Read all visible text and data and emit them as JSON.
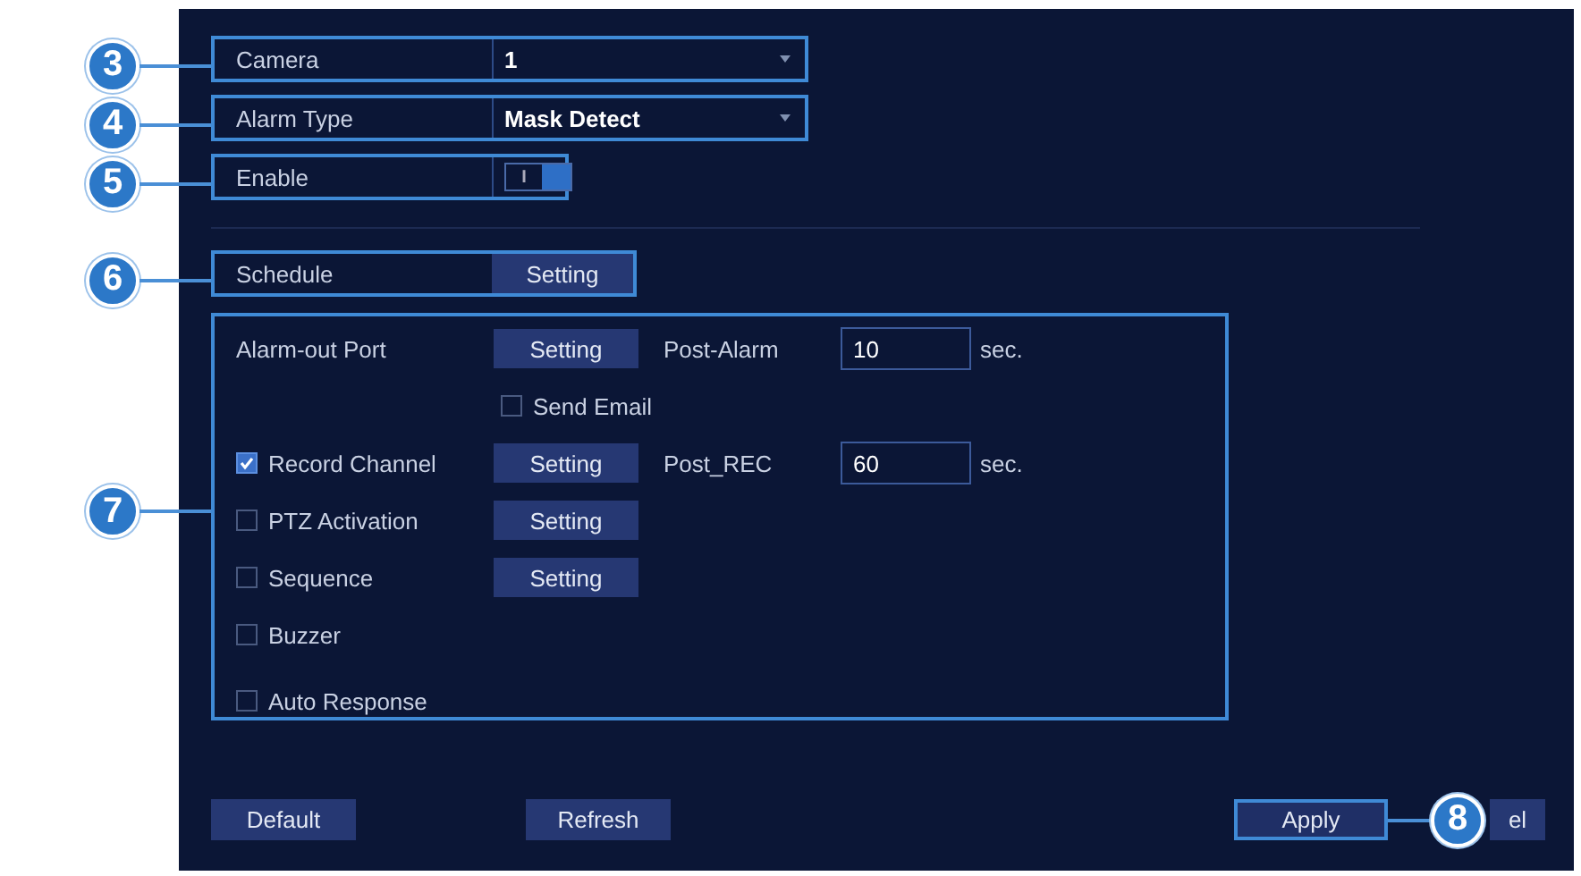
{
  "fields": [
    {
      "kind": "dropdown",
      "label": "Camera",
      "value": "1",
      "callout": "3"
    },
    {
      "kind": "dropdown",
      "label": "Alarm Type",
      "value": "Mask Detect",
      "callout": "4"
    },
    {
      "kind": "toggle",
      "label": "Enable",
      "on": true,
      "toggle_text": "I",
      "callout": "5"
    }
  ],
  "schedule": {
    "label": "Schedule",
    "button": "Setting",
    "callout": "6"
  },
  "actions": {
    "callout": "7",
    "rows": [
      {
        "kind": "plain",
        "label": "Alarm-out Port",
        "button": "Setting",
        "extra_label": "Post-Alarm",
        "extra_value": "10",
        "extra_unit": "sec."
      },
      {
        "kind": "indented-check",
        "label": "Send Email",
        "checked": false
      },
      {
        "kind": "check",
        "label": "Record Channel",
        "checked": true,
        "button": "Setting",
        "extra_label": "Post_REC",
        "extra_value": "60",
        "extra_unit": "sec."
      },
      {
        "kind": "check",
        "label": "PTZ Activation",
        "checked": false,
        "button": "Setting"
      },
      {
        "kind": "check",
        "label": "Sequence",
        "checked": false,
        "button": "Setting"
      },
      {
        "kind": "check",
        "label": "Buzzer",
        "checked": false
      },
      {
        "kind": "check",
        "label": "Auto Response",
        "checked": false
      }
    ]
  },
  "buttons": [
    {
      "label": "Default"
    },
    {
      "label": "Refresh"
    },
    {
      "label": "Apply",
      "callout": "8"
    },
    {
      "label": "el"
    }
  ]
}
